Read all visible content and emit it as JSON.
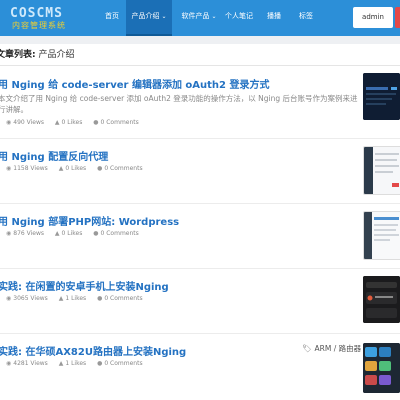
{
  "nav": {
    "logo_main": "COSCMS",
    "logo_sub": "内容管理系统",
    "items": [
      {
        "label": "首页"
      },
      {
        "label": "产品介绍",
        "dropdown": true
      },
      {
        "label": "软件产品",
        "dropdown": true
      },
      {
        "label": "个人笔记"
      },
      {
        "label": "播播"
      },
      {
        "label": "标签"
      }
    ],
    "admin_label": "admin"
  },
  "breadcrumb": {
    "prefix": "文章列表:",
    "current": "产品介绍"
  },
  "posts": [
    {
      "title": "用 Nging 给 code-server 编辑器添加 oAuth2 登录方式",
      "excerpt": "本文介绍了用 Nging 给 code-server 添加 oAuth2 登录功能的操作方法，以 Nging 后台账号作为案例来进行讲解。",
      "views": "490 Views",
      "likes": "0 Likes",
      "comments": "0 Comments"
    },
    {
      "title": "用 Nging 配置反向代理",
      "views": "1158 Views",
      "likes": "0 Likes",
      "comments": "0 Comments"
    },
    {
      "title": "用 Nging 部署PHP网站: Wordpress",
      "views": "876 Views",
      "likes": "0 Likes",
      "comments": "0 Comments"
    },
    {
      "title": "实践: 在闲置的安卓手机上安装Nging",
      "views": "3065 Views",
      "likes": "1 Likes",
      "comments": "0 Comments"
    },
    {
      "title": "实践: 在华硕AX82U路由器上安装Nging",
      "views": "4281 Views",
      "likes": "1 Likes",
      "comments": "0 Comments",
      "tags": [
        "ARM",
        "路由器"
      ]
    }
  ],
  "icons": {
    "views": "eye-icon",
    "likes": "thumbs-up-icon",
    "comments": "comment-icon",
    "tags": "tag-icon"
  },
  "colors": {
    "nav": "#2c8fd8",
    "nav_active": "#1b6fb6",
    "title_link": "#2472c2",
    "admin_red": "#e34949"
  }
}
